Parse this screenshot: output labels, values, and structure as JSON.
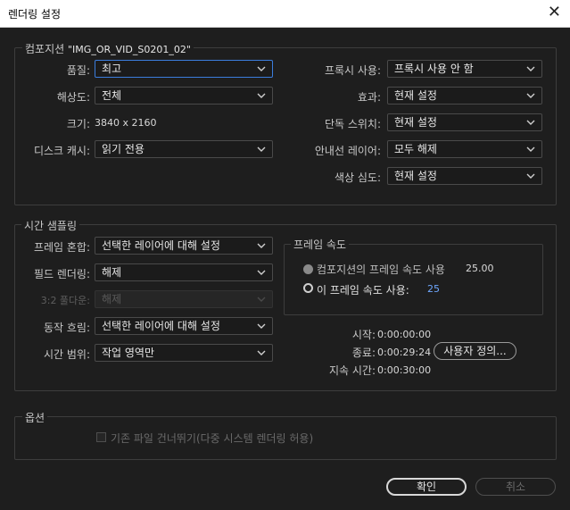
{
  "window": {
    "title": "렌더링 설정",
    "close": "✕"
  },
  "composition": {
    "group_label_prefix": "컴포지션",
    "group_label_name": "\"IMG_OR_VID_S0201_02\"",
    "quality_label": "품질:",
    "quality_value": "최고",
    "resolution_label": "해상도:",
    "resolution_value": "전체",
    "size_label": "크기:",
    "size_value": "3840 x 2160",
    "disk_cache_label": "디스크 캐시:",
    "disk_cache_value": "읽기 전용",
    "proxy_label": "프록시 사용:",
    "proxy_value": "프록시 사용 안 함",
    "effects_label": "효과:",
    "effects_value": "현재 설정",
    "solo_label": "단독 스위치:",
    "solo_value": "현재 설정",
    "guide_label": "안내선 레이어:",
    "guide_value": "모두 해제",
    "color_depth_label": "색상 심도:",
    "color_depth_value": "현재 설정"
  },
  "time_sampling": {
    "group_label": "시간 샘플링",
    "frame_blend_label": "프레임 혼합:",
    "frame_blend_value": "선택한 레이어에 대해 설정",
    "field_render_label": "필드 렌더링:",
    "field_render_value": "해제",
    "pulldown_label": "3:2 풀다운:",
    "pulldown_value": "해제",
    "motion_blur_label": "동작 흐림:",
    "motion_blur_value": "선택한 레이어에 대해 설정",
    "time_span_label": "시간 범위:",
    "time_span_value": "작업 영역만",
    "frame_rate": {
      "group_label": "프레임 속도",
      "use_comp_label": "컴포지션의 프레임 속도 사용",
      "use_comp_value": "25.00",
      "use_this_label": "이 프레임 속도 사용:",
      "use_this_value": "25"
    },
    "start_label": "시작:",
    "start_value": "0:00:00:00",
    "end_label": "종료:",
    "end_value": "0:00:29:24",
    "custom_button": "사용자 정의...",
    "duration_label": "지속 시간:",
    "duration_value": "0:00:30:00"
  },
  "options": {
    "group_label": "옵션",
    "skip_existing_label": "기존 파일 건너뛰기(다중 시스템 렌더링 허용)"
  },
  "footer": {
    "ok_label": "확인",
    "cancel_label": "취소"
  },
  "colors": {
    "focus_blue": "#3b7ddd",
    "value_blue": "#6fa8ff"
  }
}
